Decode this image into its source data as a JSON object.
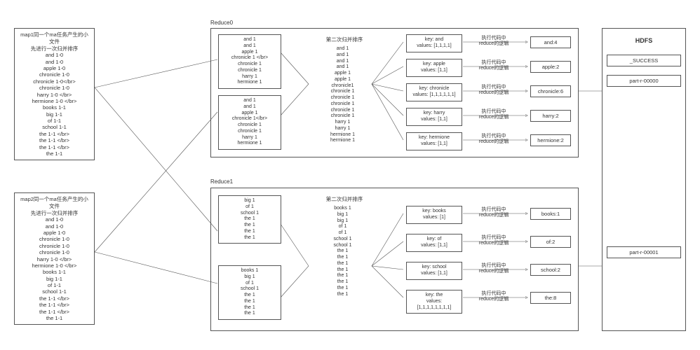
{
  "map1": {
    "title": "map1同一个ma任务产生的小文件\n先进行一次归并排序",
    "lines": [
      "and 1-0",
      "and 1-0",
      "apple 1-0",
      "chronicle 1-0",
      "chronicle 1-0</br>",
      "chronicle 1-0",
      "harry 1-0 </br>",
      "hermione 1-0 </br>",
      "books 1-1",
      "big 1-1",
      "of 1-1",
      "school 1-1",
      "the 1-1 </br>",
      "the 1-1 </br>",
      "the 1-1 </br>",
      "the 1-1"
    ]
  },
  "map2": {
    "title": "map2同一个ma任务产生的小文件\n先进行一次归并排序",
    "lines": [
      "and 1-0",
      "and 1-0",
      "apple 1-0",
      "chronicle 1-0",
      "chronicle 1-0",
      "chronicle 1-0",
      "harry 1-0 </br>",
      "hermione 1-0 </br>",
      "books 1-1",
      "big 1-1",
      "of 1-1",
      "school 1-1",
      "the 1-1 </br>",
      "the 1-1  </br>",
      "the 1-1 </br>",
      "the 1-1"
    ]
  },
  "reduce0": {
    "label": "Reduce0",
    "in1": [
      "and 1",
      "and 1",
      "apple 1",
      "chronicle 1 </br>",
      "chronicle 1",
      "chronicle 1",
      "harry 1",
      "hermione 1"
    ],
    "in2": [
      "and 1",
      "and 1",
      "apple 1",
      "chronicle 1</br>",
      "chronicle 1",
      "chronicle 1",
      "harry 1",
      "hermione 1"
    ],
    "merge_title": "第二次归并排序",
    "merged": [
      "and 1",
      "and 1",
      "and 1",
      "and 1",
      "apple 1",
      "apple 1",
      "chronicle1",
      "chronicle 1",
      "chronicle 1",
      "chronicle 1",
      "chronicle 1",
      "chronicle 1",
      "harry 1",
      "harry 1",
      "hermione 1",
      "hermione 1"
    ],
    "kvpairs": [
      {
        "k": "key: and",
        "v": "values: [1,1,1,1]"
      },
      {
        "k": "key: apple",
        "v": "values: [1,1]"
      },
      {
        "k": "key: chronicle",
        "v": "values: [1,1,1,1,1,1]"
      },
      {
        "k": "key: harry",
        "v": "values: [1,1]"
      },
      {
        "k": "key: hermione",
        "v": "values: [1,1]"
      }
    ],
    "exec_label": "执行代码中\nreduce的逻辑",
    "results": [
      "and:4",
      "apple:2",
      "chronicle:6",
      "harry:2",
      "hermione:2"
    ]
  },
  "reduce1": {
    "label": "Reduce1",
    "in1": [
      "big 1",
      "of 1",
      "school 1",
      "the 1",
      "the 1",
      "the 1",
      "the 1"
    ],
    "in2": [
      "books 1",
      "big 1",
      "of 1",
      "school 1",
      "the 1",
      "the 1",
      "the 1",
      "the 1"
    ],
    "merge_title": "第二次归并排序",
    "merged": [
      "books 1",
      "big 1",
      "big 1",
      "of 1",
      "of 1",
      "school 1",
      "school 1",
      "the 1",
      "the 1",
      "the 1",
      "the 1",
      "the 1",
      "the 1",
      "the 1",
      "the 1"
    ],
    "kvpairs": [
      {
        "k": "key: books",
        "v": "values: [1]"
      },
      {
        "k": "key: of",
        "v": "values: [1,1]"
      },
      {
        "k": "key: school",
        "v": "values: [1,1]"
      },
      {
        "k": "key: the",
        "v": "values: [1,1,1,1,1,1,1,1]"
      }
    ],
    "exec_label": "执行代码中\nreduce的逻辑",
    "results": [
      "books:1",
      "of:2",
      "school:2",
      "the:8"
    ]
  },
  "hdfs": {
    "title": "HDFS",
    "success": "_SUCCESS",
    "part0": "part-r-00000",
    "part1": "part-r-00001"
  }
}
